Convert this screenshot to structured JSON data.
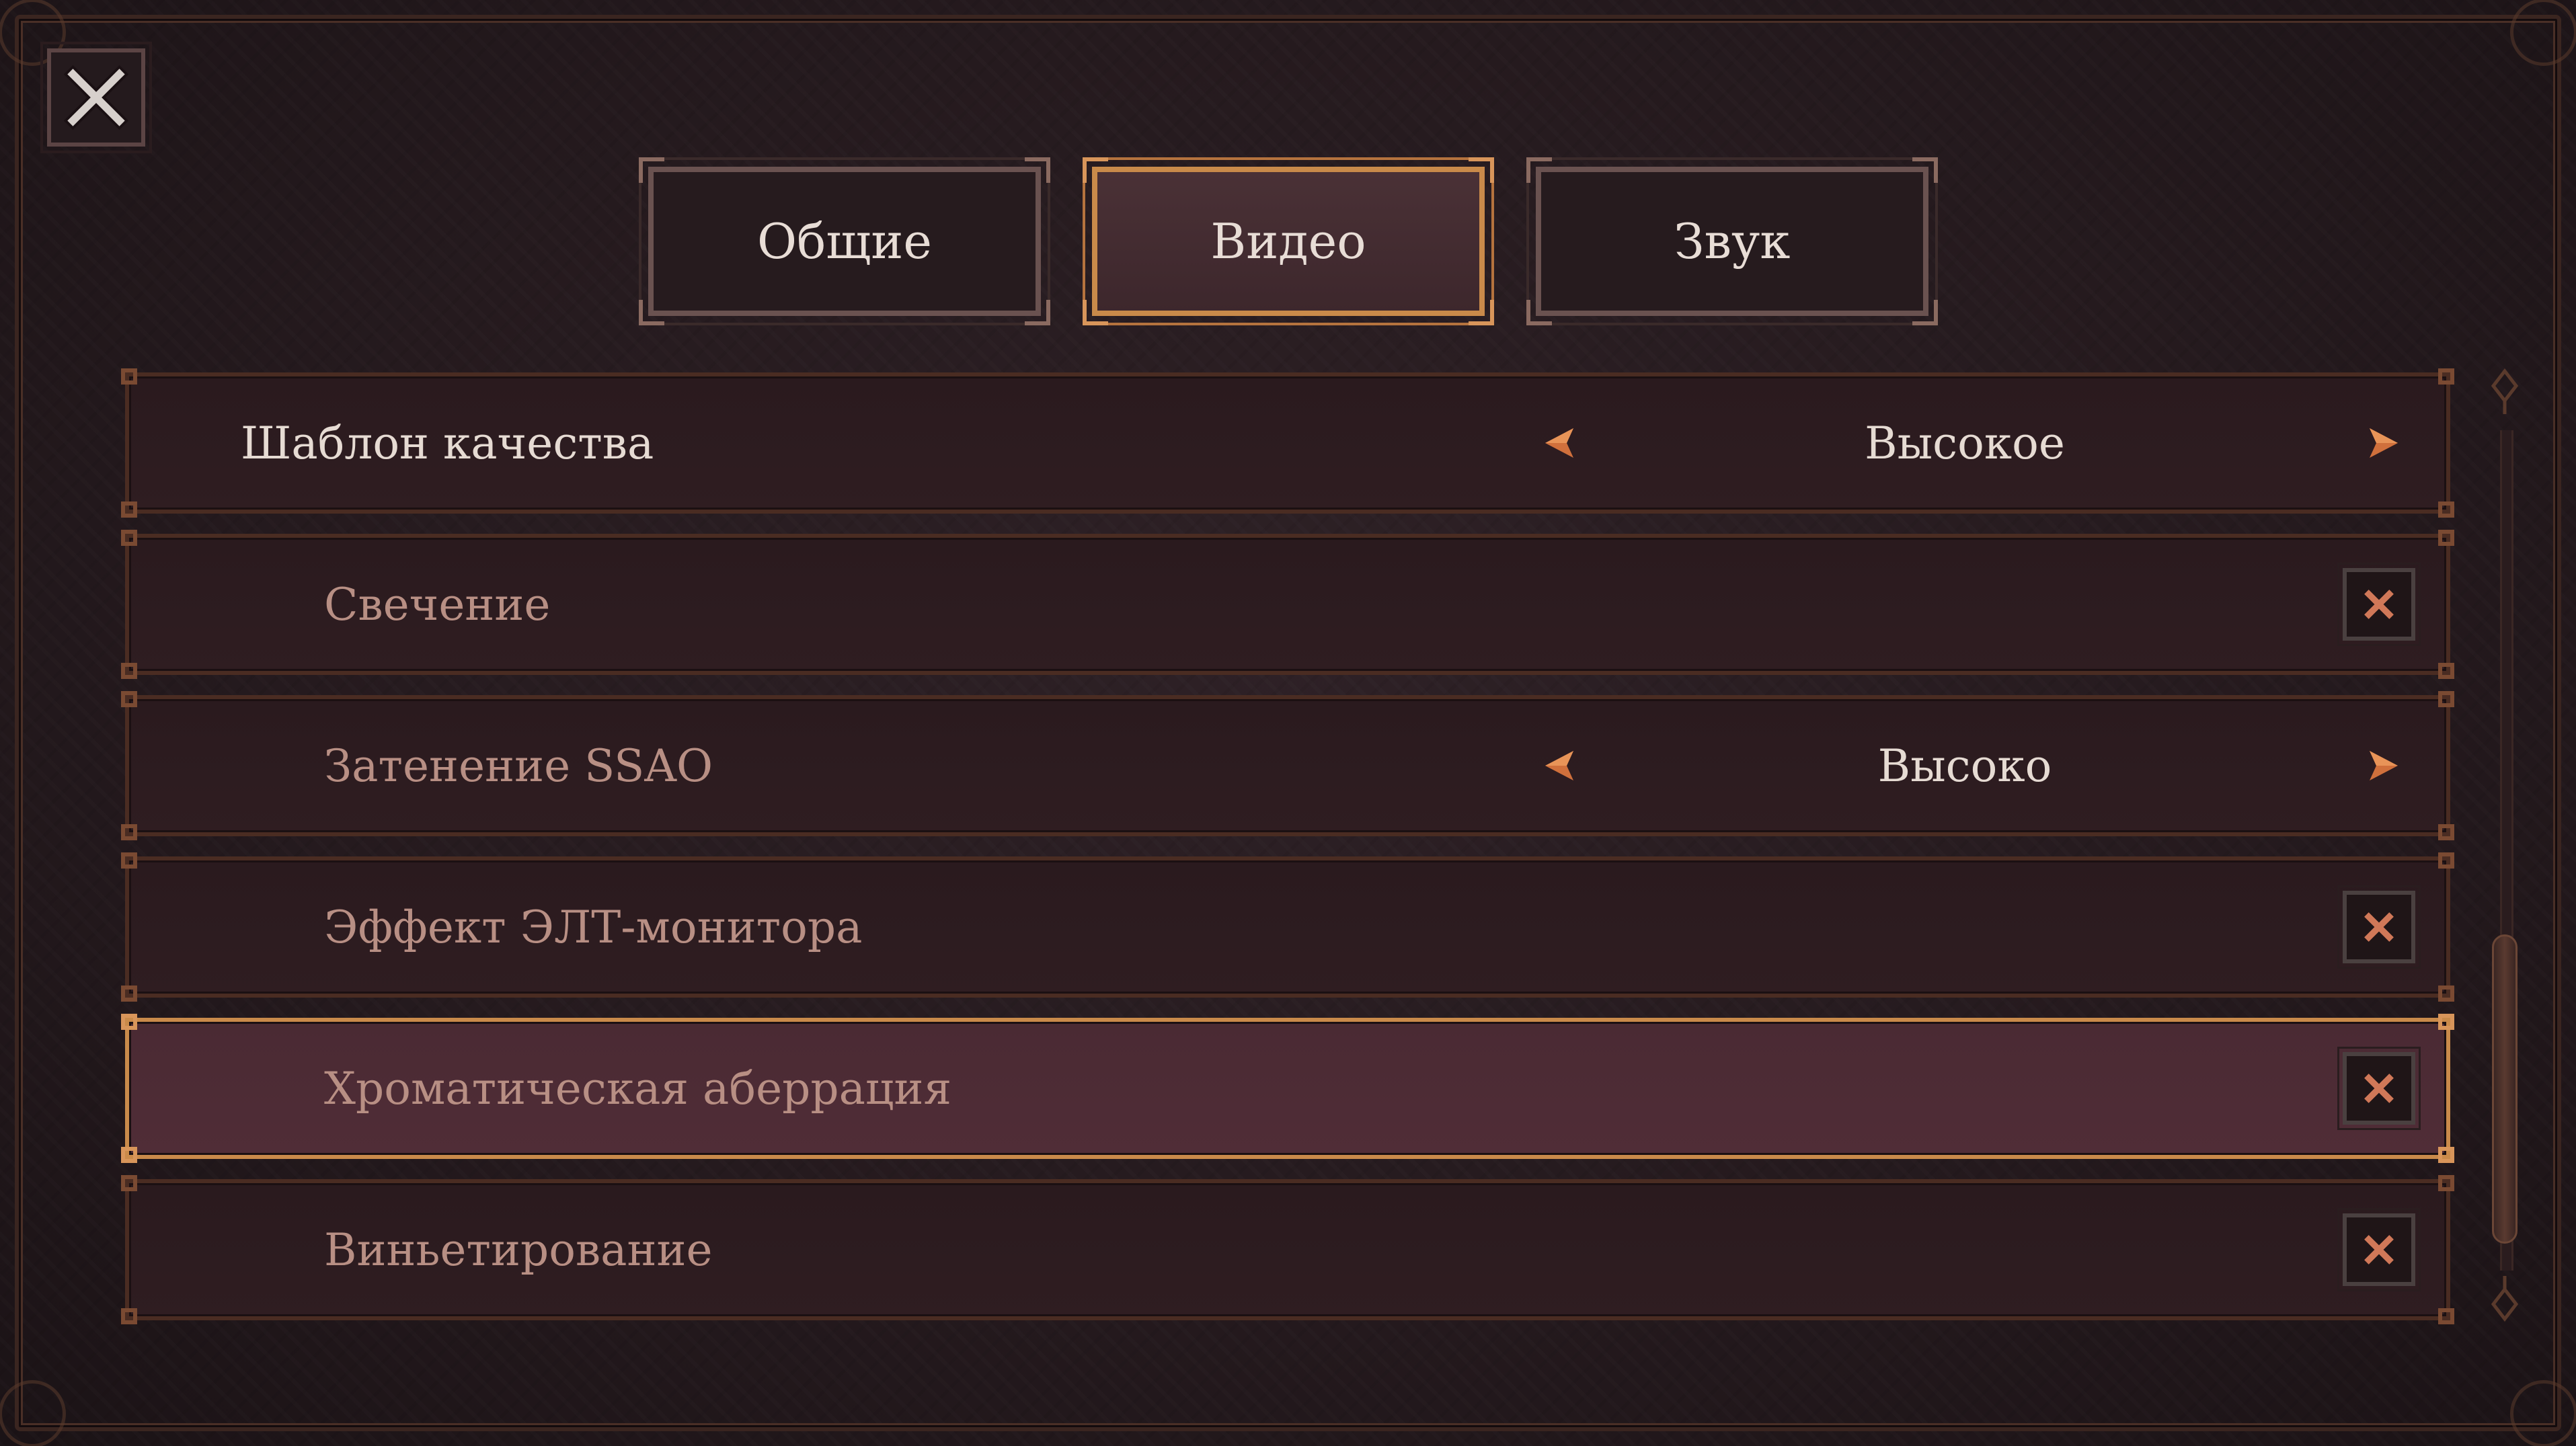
{
  "close": {
    "icon": "close-icon"
  },
  "tabs": [
    {
      "label": "Общие",
      "active": false
    },
    {
      "label": "Видео",
      "active": true
    },
    {
      "label": "Звук",
      "active": false
    }
  ],
  "settings": [
    {
      "label": "Шаблон качества",
      "type": "select",
      "value": "Высокое",
      "level": "primary",
      "highlighted": false
    },
    {
      "label": "Свечение",
      "type": "checkbox",
      "checked": true,
      "level": "sub",
      "highlighted": false
    },
    {
      "label": "Затенение SSAO",
      "type": "select",
      "value": "Высоко",
      "level": "sub",
      "highlighted": false
    },
    {
      "label": "Эффект ЭЛТ-монитора",
      "type": "checkbox",
      "checked": true,
      "level": "sub",
      "highlighted": false
    },
    {
      "label": "Хроматическая аберрация",
      "type": "checkbox",
      "checked": true,
      "level": "sub",
      "highlighted": true
    },
    {
      "label": "Виньетирование",
      "type": "checkbox",
      "checked": true,
      "level": "sub",
      "highlighted": false
    }
  ],
  "scrollbar": {
    "position": 0.85
  },
  "colors": {
    "accent": "#c98a4a",
    "arrow": "#d0703c",
    "checkmark": "#d07858",
    "text_primary": "#e6dbd3",
    "text_secondary": "#b88f84",
    "background": "#251a1e"
  }
}
